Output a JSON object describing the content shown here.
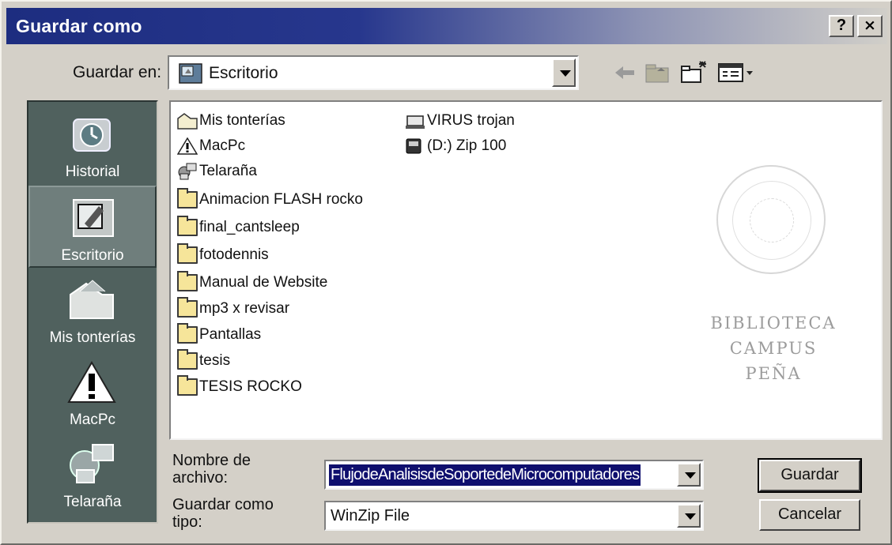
{
  "window": {
    "title": "Guardar como",
    "help_label": "?",
    "close_label": "×"
  },
  "save_in": {
    "label": "Guardar en:",
    "value": "Escritorio",
    "icon": "desktop-icon"
  },
  "toolbar": [
    "back-arrow-icon",
    "up-folder-icon",
    "new-folder-icon",
    "view-menu-icon"
  ],
  "places": [
    {
      "label": "Historial",
      "icon": "history-icon"
    },
    {
      "label": "Escritorio",
      "icon": "desktop-icon",
      "selected": true
    },
    {
      "label": "Mis tonterías",
      "icon": "my-documents-icon"
    },
    {
      "label": "MacPc",
      "icon": "warning-icon"
    },
    {
      "label": "Telaraña",
      "icon": "network-icon"
    }
  ],
  "files": [
    {
      "name": "Mis tonterías",
      "icon": "documents-folder-icon"
    },
    {
      "name": "MacPc",
      "icon": "warning-icon"
    },
    {
      "name": "Telaraña",
      "icon": "network-icon"
    },
    {
      "name": "Animacion FLASH rocko",
      "icon": "folder-icon"
    },
    {
      "name": "final_cantsleep",
      "icon": "folder-icon"
    },
    {
      "name": "fotodennis",
      "icon": "folder-icon"
    },
    {
      "name": "Manual de Website",
      "icon": "folder-icon"
    },
    {
      "name": "mp3 x revisar",
      "icon": "folder-icon"
    },
    {
      "name": "Pantallas",
      "icon": "folder-icon"
    },
    {
      "name": "tesis",
      "icon": "folder-icon"
    },
    {
      "name": "TESIS ROCKO",
      "icon": "folder-icon"
    },
    {
      "name": "VIRUS trojan",
      "icon": "shared-folder-icon"
    },
    {
      "name": "(D:) Zip 100",
      "icon": "zip-drive-icon"
    }
  ],
  "watermark": {
    "lines": [
      "BIBLIOTECA",
      "CAMPUS",
      "PEÑA"
    ]
  },
  "filename": {
    "label_line1": "Nombre de",
    "label_line2": "archivo:",
    "value": "FlujodeAnalisisdeSoportedeMicrocomputadores"
  },
  "filetype": {
    "label_line1": "Guardar como",
    "label_line2": "tipo:",
    "value": "WinZip File"
  },
  "buttons": {
    "save": "Guardar",
    "cancel": "Cancelar"
  }
}
